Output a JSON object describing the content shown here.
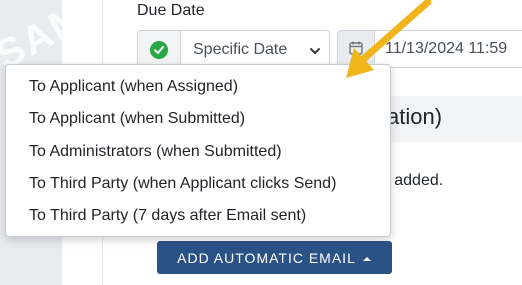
{
  "due_date": {
    "label": "Due Date",
    "mode_value": "Specific Date",
    "date_value": "11/13/2024 11:59"
  },
  "section": {
    "title_fragment": "cation)",
    "info_fragment": "en added."
  },
  "add_button": {
    "label": "ADD AUTOMATIC EMAIL"
  },
  "menu": {
    "items": [
      "To Applicant (when Assigned)",
      "To Applicant (when Submitted)",
      "To Administrators (when Submitted)",
      "To Third Party (when Applicant clicks Send)",
      "To Third Party (7 days after Email sent)"
    ]
  },
  "watermark": "SAM",
  "colors": {
    "button_bg": "#2b5286",
    "check_green": "#28a745",
    "arrow": "#f2b41b"
  },
  "icons": {
    "check": "check-circle-icon",
    "chevron": "chevron-down-icon",
    "calendar": "calendar-icon",
    "caret": "caret-up-icon",
    "arrow": "annotation-arrow-icon"
  }
}
